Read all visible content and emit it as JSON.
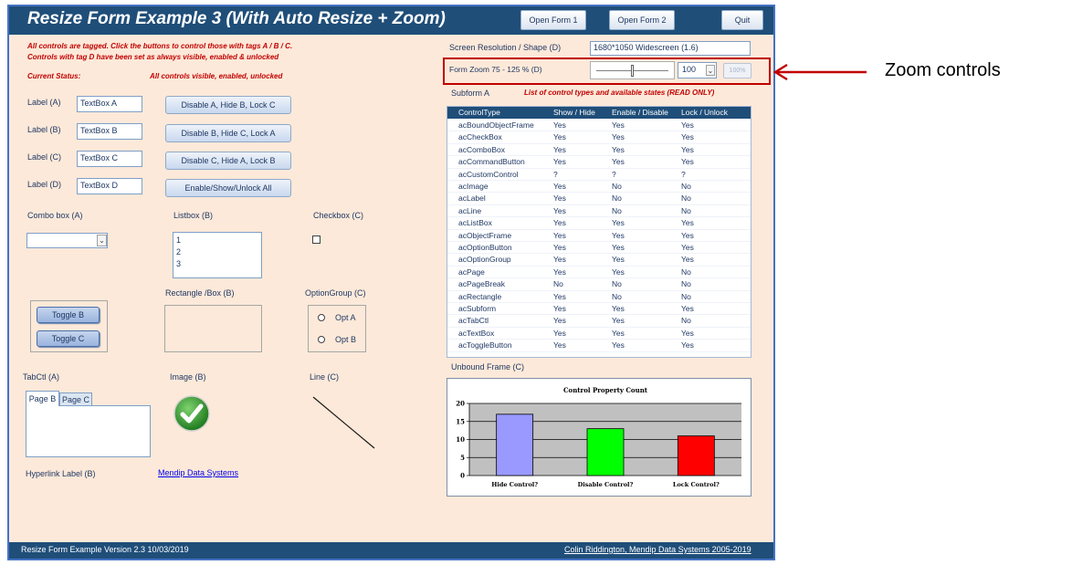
{
  "title": "Resize Form Example 3 (With Auto Resize + Zoom)",
  "top_buttons": {
    "open_form1": "Open Form 1",
    "open_form2": "Open Form 2",
    "quit": "Quit"
  },
  "intro": {
    "line1": "All controls are tagged. Click the buttons to control those with tags A / B / C.",
    "line2": "Controls with tag D have been set as always visible, enabled & unlocked"
  },
  "status": {
    "label": "Current Status:",
    "value": "All controls visible, enabled, unlocked"
  },
  "labels": [
    {
      "label": "Label (A)",
      "textbox": "TextBox A",
      "button": "Disable A, Hide B, Lock C"
    },
    {
      "label": "Label (B)",
      "textbox": "TextBox B",
      "button": "Disable B, Hide C, Lock A"
    },
    {
      "label": "Label (C)",
      "textbox": "TextBox C",
      "button": "Disable C, Hide A, Lock B"
    },
    {
      "label": "Label (D)",
      "textbox": "TextBox D",
      "button": "Enable/Show/Unlock All"
    }
  ],
  "combo": {
    "label": "Combo box (A)",
    "value": ""
  },
  "listbox": {
    "label": "Listbox  (B)",
    "items": [
      "1",
      "2",
      "3"
    ]
  },
  "checkbox": {
    "label": "Checkbox (C)"
  },
  "toggles": [
    "Toggle B",
    "Toggle C"
  ],
  "rectangle_label": "Rectangle /Box (B)",
  "optiongroup": {
    "label": "OptionGroup (C)",
    "options": [
      "Opt A",
      "Opt B"
    ]
  },
  "tabctl": {
    "label": "TabCtl (A)",
    "tabs": [
      "Page B",
      "Page C"
    ]
  },
  "image_label": "Image (B)",
  "line_label": "Line (C)",
  "hyperlink": {
    "label": "Hyperlink Label (B)",
    "link": "Mendip Data Systems"
  },
  "screen": {
    "label": "Screen Resolution / Shape (D)",
    "value": "1680*1050 Widescreen (1.6)"
  },
  "zoom": {
    "label": "Form Zoom  75 - 125 %   (D)",
    "value": "100",
    "button": "100%",
    "slider_fraction": 0.5
  },
  "annotation": "Zoom controls",
  "subform": {
    "label": "Subform A",
    "note": "List of control types and available states   (READ ONLY)",
    "columns": [
      "ControlType",
      "Show / Hide",
      "Enable / Disable",
      "Lock / Unlock"
    ],
    "rows": [
      [
        "acBoundObjectFrame",
        "Yes",
        "Yes",
        "Yes"
      ],
      [
        "acCheckBox",
        "Yes",
        "Yes",
        "Yes"
      ],
      [
        "acComboBox",
        "Yes",
        "Yes",
        "Yes"
      ],
      [
        "acCommandButton",
        "Yes",
        "Yes",
        "Yes"
      ],
      [
        "acCustomControl",
        "?",
        "?",
        "?"
      ],
      [
        "acImage",
        "Yes",
        "No",
        "No"
      ],
      [
        "acLabel",
        "Yes",
        "No",
        "No"
      ],
      [
        "acLine",
        "Yes",
        "No",
        "No"
      ],
      [
        "acListBox",
        "Yes",
        "Yes",
        "Yes"
      ],
      [
        "acObjectFrame",
        "Yes",
        "Yes",
        "Yes"
      ],
      [
        "acOptionButton",
        "Yes",
        "Yes",
        "Yes"
      ],
      [
        "acOptionGroup",
        "Yes",
        "Yes",
        "Yes"
      ],
      [
        "acPage",
        "Yes",
        "Yes",
        "No"
      ],
      [
        "acPageBreak",
        "No",
        "No",
        "No"
      ],
      [
        "acRectangle",
        "Yes",
        "No",
        "No"
      ],
      [
        "acSubform",
        "Yes",
        "Yes",
        "Yes"
      ],
      [
        "acTabCtl",
        "Yes",
        "Yes",
        "No"
      ],
      [
        "acTextBox",
        "Yes",
        "Yes",
        "Yes"
      ],
      [
        "acToggleButton",
        "Yes",
        "Yes",
        "Yes"
      ]
    ]
  },
  "unbound_label": "Unbound Frame (C)",
  "chart_data": {
    "type": "bar",
    "title": "Control Property Count",
    "categories": [
      "Hide Control?",
      "Disable Control?",
      "Lock Control?"
    ],
    "values": [
      17,
      13,
      11
    ],
    "colors": [
      "#9999ff",
      "#00ff00",
      "#ff0000"
    ],
    "ylim": [
      0,
      20
    ],
    "yticks": [
      0,
      5,
      10,
      15,
      20
    ],
    "grid": true,
    "xlabel": "",
    "ylabel": ""
  },
  "footer": {
    "left": "Resize Form Example   Version 2.3  10/03/2019",
    "right": "Colin Riddington, Mendip Data Systems 2005-2019"
  },
  "colors": {
    "form_bg": "#fde9d9",
    "title_bar": "#1f4e79",
    "accent_red": "#c00000",
    "highlight_border": "#c00000"
  }
}
